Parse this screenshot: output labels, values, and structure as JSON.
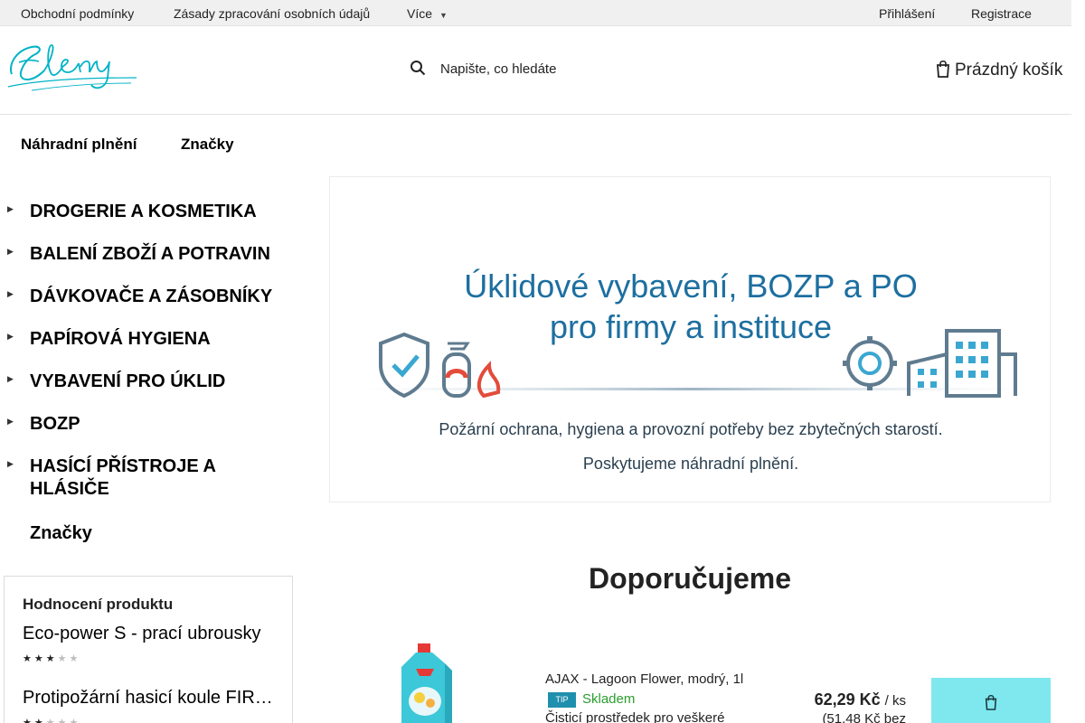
{
  "topbar": {
    "links": [
      "Obchodní podmínky",
      "Zásady zpracování osobních údajů",
      "Více"
    ],
    "login": "Přihlášení",
    "register": "Registrace"
  },
  "header": {
    "logo_text": "Eleny",
    "search_placeholder": "Napište, co hledáte",
    "cart_label": "Prázdný košík"
  },
  "subnav": [
    "Náhradní plnění",
    "Značky"
  ],
  "categories": [
    "DROGERIE A KOSMETIKA",
    "BALENÍ ZBOŽÍ A POTRAVIN",
    "DÁVKOVAČE A ZÁSOBNÍKY",
    "PAPÍROVÁ HYGIENA",
    "VYBAVENÍ PRO ÚKLID",
    "BOZP",
    "HASÍCÍ PŘÍSTROJE A HLÁSIČE",
    "Značky"
  ],
  "ratings": {
    "title": "Hodnocení produktu",
    "items": [
      {
        "name": "Eco-power S - prací ubrousky",
        "stars": 3
      },
      {
        "name": "Protipožární hasicí koule FIREBALL",
        "stars": 2
      }
    ]
  },
  "banner": {
    "title_line1": "Úklidové vybavení, BOZP a PO",
    "title_line2": "pro firmy a instituce",
    "sub_line1": "Požární ochrana, hygiena a provozní potřeby bez zbytečných starostí.",
    "sub_line2": "Poskytujeme náhradní plnění.",
    "accent_color": "#1d6fa0"
  },
  "recommended": {
    "title": "Doporučujeme",
    "product": {
      "name": "AJAX - Lagoon Flower, modrý, 1l",
      "badge": "TIP",
      "stock": "Skladem",
      "description": "Čisticí prostředek pro veškeré",
      "price": "62,29 Kč",
      "unit": "/ ks",
      "price_novat": "(51,48 Kč bez"
    }
  },
  "colors": {
    "brand": "#00b3c6",
    "buy_button": "#7fe8ef",
    "stock": "#2a9d2e",
    "tip": "#1f8fae"
  }
}
